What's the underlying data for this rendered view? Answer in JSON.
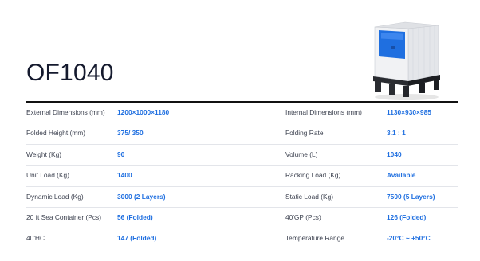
{
  "title": "OF1040",
  "colors": {
    "accent": "#1f6fe0",
    "title_text": "#151a2e",
    "rule": "#111111",
    "row_divider": "#e3e5ea"
  },
  "product_image": {
    "icon": "pallet-box-container-image"
  },
  "specs": [
    {
      "left_label": "External Dimensions (mm)",
      "left_value": "1200×1000×1180",
      "right_label": "Internal Dimensions (mm)",
      "right_value": "1130×930×985"
    },
    {
      "left_label": "Folded Height (mm)",
      "left_value": "375/ 350",
      "right_label": "Folding Rate",
      "right_value": "3.1 : 1"
    },
    {
      "left_label": "Weight (Kg)",
      "left_value": "90",
      "right_label": "Volume (L)",
      "right_value": "1040"
    },
    {
      "left_label": "Unit Load (Kg)",
      "left_value": "1400",
      "right_label": "Racking Load (Kg)",
      "right_value": "Available"
    },
    {
      "left_label": "Dynamic Load (Kg)",
      "left_value": "3000 (2 Layers)",
      "right_label": "Static Load (Kg)",
      "right_value": "7500 (5 Layers)"
    },
    {
      "left_label": "20 ft Sea Container (Pcs)",
      "left_value": "56 (Folded)",
      "right_label": "40'GP (Pcs)",
      "right_value": "126 (Folded)"
    },
    {
      "left_label": "40'HC",
      "left_value": "147 (Folded)",
      "right_label": "Temperature Range",
      "right_value": "-20°C ~ +50°C"
    }
  ]
}
